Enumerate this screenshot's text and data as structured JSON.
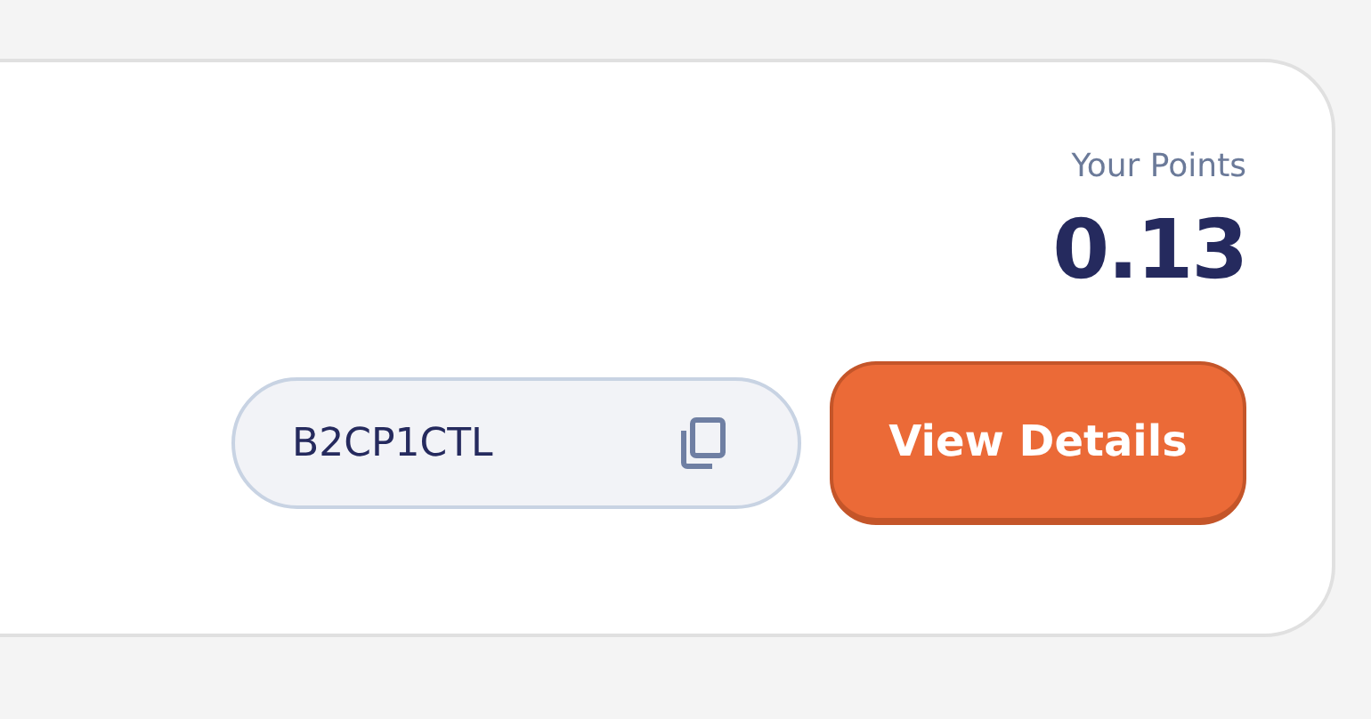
{
  "points": {
    "label": "Your Points",
    "value": "0.13"
  },
  "referral_code": {
    "code": "B2CP1CTL"
  },
  "buttons": [
    {
      "label": "View Details"
    }
  ]
}
